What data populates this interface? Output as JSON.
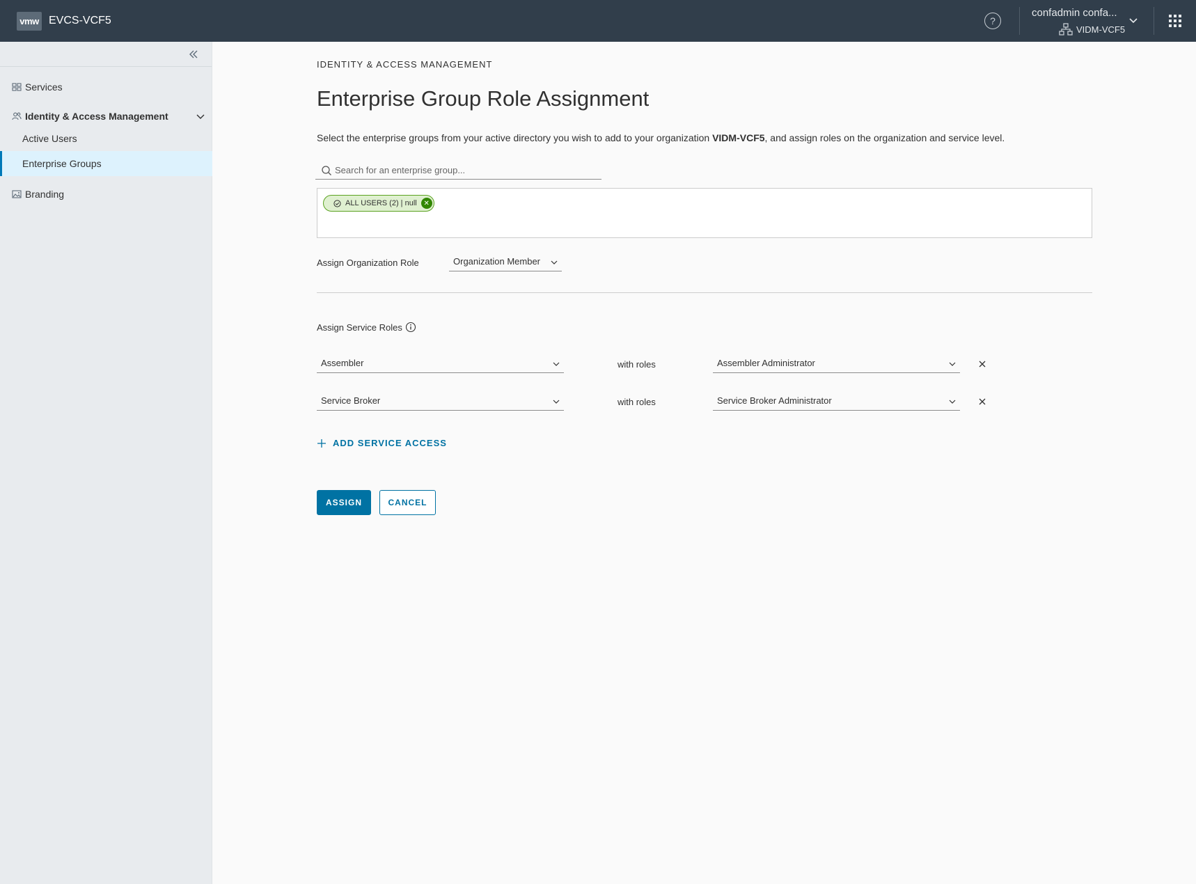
{
  "header": {
    "logo_text": "vmw",
    "app_title": "EVCS-VCF5",
    "help_icon": "help-circle-icon",
    "user_name": "confadmin confa...",
    "org_name": "VIDM-VCF5"
  },
  "sidebar": {
    "services": "Services",
    "iam": "Identity & Access Management",
    "active_users": "Active Users",
    "enterprise_groups": "Enterprise Groups",
    "branding": "Branding"
  },
  "main": {
    "breadcrumb": "IDENTITY & ACCESS MANAGEMENT",
    "title": "Enterprise Group Role Assignment",
    "intro_before": "Select the enterprise groups from your active directory you wish to add to your organization ",
    "intro_org": "VIDM-VCF5",
    "intro_after": ", and assign roles on the organization and service level.",
    "search_placeholder": "Search for an enterprise group...",
    "selected_group_chip": "ALL USERS (2) | null",
    "org_role_label": "Assign Organization Role",
    "org_role_value": "Organization Member",
    "service_roles_label": "Assign Service Roles",
    "service_rows": [
      {
        "service": "Assembler",
        "with_label": "with roles",
        "role": "Assembler Administrator"
      },
      {
        "service": "Service Broker",
        "with_label": "with roles",
        "role": "Service Broker Administrator"
      }
    ],
    "add_service_access": "ADD SERVICE ACCESS",
    "assign_button": "ASSIGN",
    "cancel_button": "CANCEL"
  },
  "colors": {
    "header_bg": "#313e4b",
    "sidebar_bg": "#e8ebee",
    "active_nav_bg": "#ddf2fd",
    "primary": "#0072a3",
    "chip_bg": "#dff0d0",
    "chip_border": "#5aa220"
  }
}
